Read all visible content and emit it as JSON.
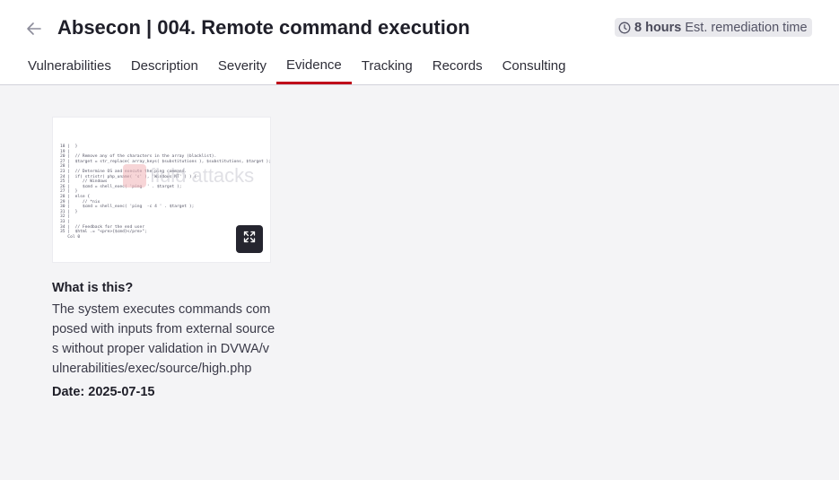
{
  "header": {
    "title": "Absecon | 004. Remote command execution",
    "remediation_hours": "8 hours",
    "remediation_label": "Est. remediation time"
  },
  "tabs": [
    {
      "label": "Vulnerabilities"
    },
    {
      "label": "Description"
    },
    {
      "label": "Severity"
    },
    {
      "label": "Evidence",
      "active": true
    },
    {
      "label": "Tracking"
    },
    {
      "label": "Records"
    },
    {
      "label": "Consulting"
    }
  ],
  "evidence": {
    "code": "18 |  }\n19 |\n20 |  // Remove any of the characters in the array (blacklist).\n27 |  $target = str_replace( array_keys( $substitutions ), $substitutions, $target );\n28 |\n23 |  // Determine OS and execute the ping command.\n24 |  if( stristr( php_uname( 's' ), 'Windows NT' ) ) {\n25 |     // Windows\n26 |     $cmd = shell_exec( 'ping  ' . $target );\n27 |  }\n28 |  else {\n29 |     // *nix\n30 |     $cmd = shell_exec( 'ping  -c 4 ' . $target );\n31 |  }\n32 |\n33 |\n34 |  // Feedback for the end user\n35 |  $html .= \"<pre>{$cmd}</pre>\";\n   Col 0",
    "watermark": "fluid attacks",
    "heading": "What is this?",
    "description": "The system executes commands composed with inputs from external sources without proper validation in DVWA/vulnerabilities/exec/source/high.php",
    "date": "Date: 2025-07-15"
  }
}
